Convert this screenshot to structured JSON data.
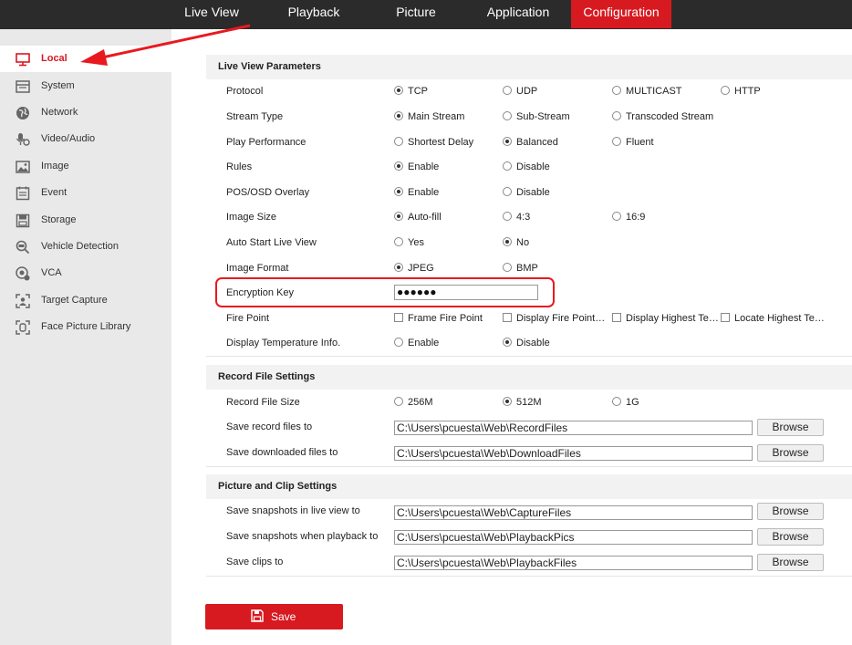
{
  "nav": {
    "tabs": [
      {
        "label": "Live View",
        "active": false
      },
      {
        "label": "Playback",
        "active": false
      },
      {
        "label": "Picture",
        "active": false
      },
      {
        "label": "Application",
        "active": false
      },
      {
        "label": "Configuration",
        "active": true
      }
    ]
  },
  "sidebar": {
    "items": [
      {
        "label": "Local",
        "icon": "monitor-icon",
        "active": true
      },
      {
        "label": "System",
        "icon": "system-icon",
        "active": false
      },
      {
        "label": "Network",
        "icon": "globe-icon",
        "active": false
      },
      {
        "label": "Video/Audio",
        "icon": "microphone-icon",
        "active": false
      },
      {
        "label": "Image",
        "icon": "image-icon",
        "active": false
      },
      {
        "label": "Event",
        "icon": "event-icon",
        "active": false
      },
      {
        "label": "Storage",
        "icon": "storage-icon",
        "active": false
      },
      {
        "label": "Vehicle Detection",
        "icon": "vehicle-detection-icon",
        "active": false
      },
      {
        "label": "VCA",
        "icon": "vca-icon",
        "active": false
      },
      {
        "label": "Target Capture",
        "icon": "target-capture-icon",
        "active": false
      },
      {
        "label": "Face Picture Library",
        "icon": "face-library-icon",
        "active": false
      }
    ]
  },
  "live_view": {
    "title": "Live View Parameters",
    "rows": [
      {
        "label": "Protocol",
        "options": [
          {
            "text": "TCP",
            "checked": true
          },
          {
            "text": "UDP",
            "checked": false
          },
          {
            "text": "MULTICAST",
            "checked": false
          },
          {
            "text": "HTTP",
            "checked": false
          }
        ]
      },
      {
        "label": "Stream Type",
        "options": [
          {
            "text": "Main Stream",
            "checked": true
          },
          {
            "text": "Sub-Stream",
            "checked": false
          },
          {
            "text": "Transcoded Stream",
            "checked": false
          }
        ]
      },
      {
        "label": "Play Performance",
        "options": [
          {
            "text": "Shortest Delay",
            "checked": false
          },
          {
            "text": "Balanced",
            "checked": true
          },
          {
            "text": "Fluent",
            "checked": false
          }
        ]
      },
      {
        "label": "Rules",
        "options": [
          {
            "text": "Enable",
            "checked": true
          },
          {
            "text": "Disable",
            "checked": false
          }
        ]
      },
      {
        "label": "POS/OSD Overlay",
        "options": [
          {
            "text": "Enable",
            "checked": true
          },
          {
            "text": "Disable",
            "checked": false
          }
        ]
      },
      {
        "label": "Image Size",
        "options": [
          {
            "text": "Auto-fill",
            "checked": true
          },
          {
            "text": "4:3",
            "checked": false
          },
          {
            "text": "16:9",
            "checked": false
          }
        ]
      },
      {
        "label": "Auto Start Live View",
        "options": [
          {
            "text": "Yes",
            "checked": false
          },
          {
            "text": "No",
            "checked": true
          }
        ]
      },
      {
        "label": "Image Format",
        "options": [
          {
            "text": "JPEG",
            "checked": true
          },
          {
            "text": "BMP",
            "checked": false
          }
        ]
      }
    ],
    "encryption_key_label": "Encryption Key",
    "encryption_key_value": "●●●●●●",
    "fire_point_label": "Fire Point",
    "fire_point_options": [
      "Frame Fire Point",
      "Display Fire Point…",
      "Display Highest Te…",
      "Locate Highest Te…"
    ],
    "temp_label": "Display Temperature Info.",
    "temp_options": [
      {
        "text": "Enable",
        "checked": false
      },
      {
        "text": "Disable",
        "checked": true
      }
    ]
  },
  "record": {
    "title": "Record File Settings",
    "size_label": "Record File Size",
    "size_options": [
      {
        "text": "256M",
        "checked": false
      },
      {
        "text": "512M",
        "checked": true
      },
      {
        "text": "1G",
        "checked": false
      }
    ],
    "paths": [
      {
        "label": "Save record files to",
        "value": "C:\\Users\\pcuesta\\Web\\RecordFiles"
      },
      {
        "label": "Save downloaded files to",
        "value": "C:\\Users\\pcuesta\\Web\\DownloadFiles"
      }
    ]
  },
  "picture": {
    "title": "Picture and Clip Settings",
    "paths": [
      {
        "label": "Save snapshots in live view to",
        "value": "C:\\Users\\pcuesta\\Web\\CaptureFiles"
      },
      {
        "label": "Save snapshots when playback to",
        "value": "C:\\Users\\pcuesta\\Web\\PlaybackPics"
      },
      {
        "label": "Save clips to",
        "value": "C:\\Users\\pcuesta\\Web\\PlaybackFiles"
      }
    ]
  },
  "browse_label": "Browse",
  "save_label": "Save",
  "colors": {
    "accent": "#d71920",
    "topbar": "#2b2b2b",
    "sidebar": "#e9e9e9"
  }
}
